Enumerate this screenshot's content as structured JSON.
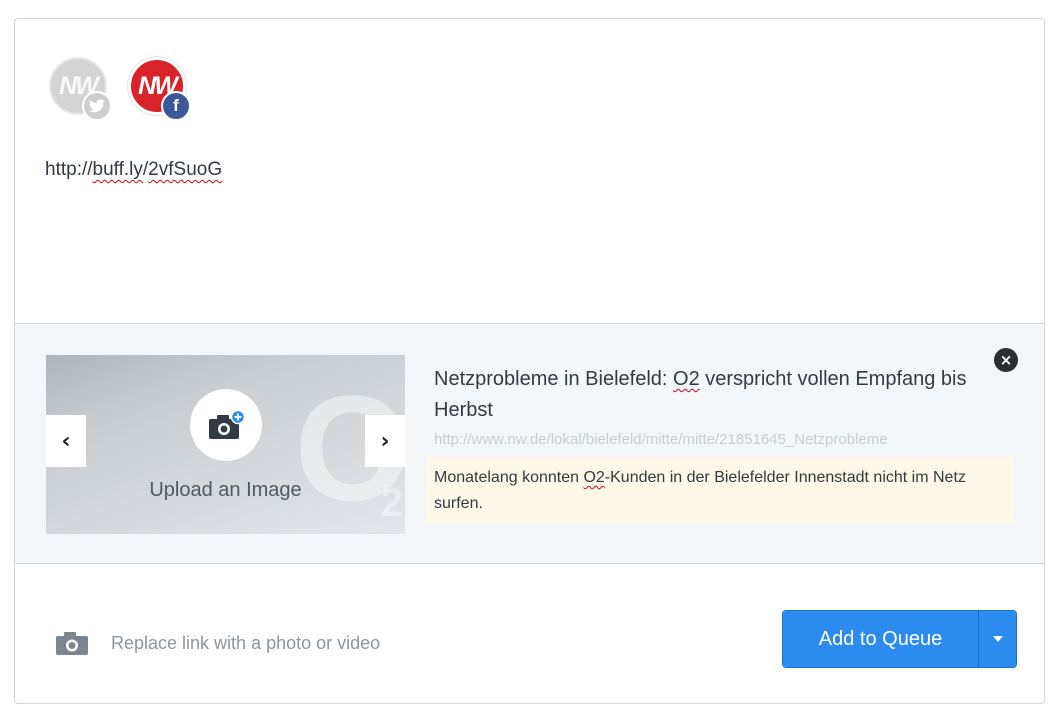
{
  "profiles": [
    {
      "logo_text": "NW",
      "network": "twitter",
      "badge_icon": "twitter-bird-icon",
      "selected": false
    },
    {
      "logo_text": "NW",
      "network": "facebook",
      "badge_icon": "facebook-f-icon",
      "selected": true
    }
  ],
  "post": {
    "text_prefix": "http://",
    "text_part1": "buff.ly",
    "text_sep": "/",
    "text_part2": "2vfSuoG"
  },
  "preview": {
    "upload_label": "Upload an Image",
    "thumbnail_watermark": "O",
    "thumbnail_watermark_sub": "2",
    "title_before": "Netzprobleme in Bielefeld: ",
    "title_spell": "O2",
    "title_after": " verspricht vollen Empfang bis Herbst",
    "url": "http://www.nw.de/lokal/bielefeld/mitte/mitte/21851645_Netzprobleme",
    "desc_before": "Monatelang konnten ",
    "desc_spell": "O2",
    "desc_after": "-Kunden in der Bielefelder Innenstadt nicht im Netz surfen.",
    "prev_icon": "‹",
    "next_icon": "›",
    "close_icon": "×"
  },
  "footer": {
    "media_label": "Replace link with a photo or video",
    "queue_button": "Add to Queue"
  },
  "colors": {
    "accent": "#2c8bef",
    "nw_red": "#d9232b",
    "facebook": "#3b5898",
    "desc_bg": "#fdf8e7"
  }
}
